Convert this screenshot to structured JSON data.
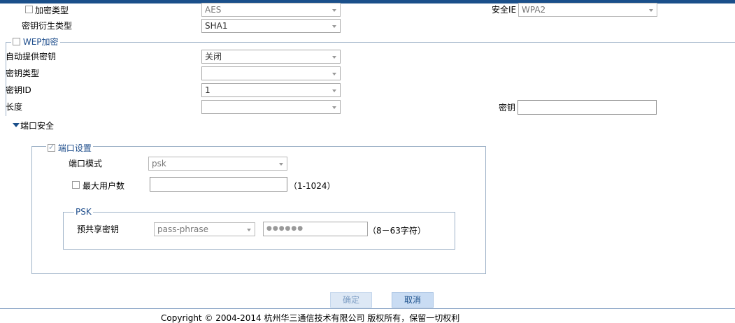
{
  "encryption": {
    "enc_type_label": "加密类型",
    "enc_type_value": "AES",
    "key_derive_label": "密钥衍生类型",
    "key_derive_value": "SHA1",
    "security_ie_label": "安全IE",
    "security_ie_value": "WPA2"
  },
  "wep": {
    "legend": "WEP加密",
    "auto_key_label": "自动提供密钥",
    "auto_key_value": "关闭",
    "key_type_label": "密钥类型",
    "key_type_value": "",
    "key_id_label": "密钥ID",
    "key_id_value": "1",
    "length_label": "长度",
    "length_value": "",
    "key_label": "密钥",
    "key_value": ""
  },
  "port_security": {
    "section_title": "端口安全",
    "port_settings_legend": "端口设置",
    "port_mode_label": "端口模式",
    "port_mode_value": "psk",
    "max_users_label": "最大用户数",
    "max_users_value": "",
    "max_users_hint": "（1-1024）",
    "psk_legend": "PSK",
    "preshared_key_label": "预共享密钥",
    "preshared_key_type": "pass-phrase",
    "preshared_key_value": "●●●●●●",
    "preshared_key_hint": "（8－63字符）"
  },
  "buttons": {
    "ok_label": "确定",
    "cancel_label": "取消"
  },
  "footer": {
    "copyright": "Copyright © 2004-2014 杭州华三通信技术有限公司  版权所有，保留一切权利"
  },
  "colors": {
    "accent": "#1a4f8a",
    "border": "#9fb3c8",
    "button_bg": "#c9dcf3"
  }
}
